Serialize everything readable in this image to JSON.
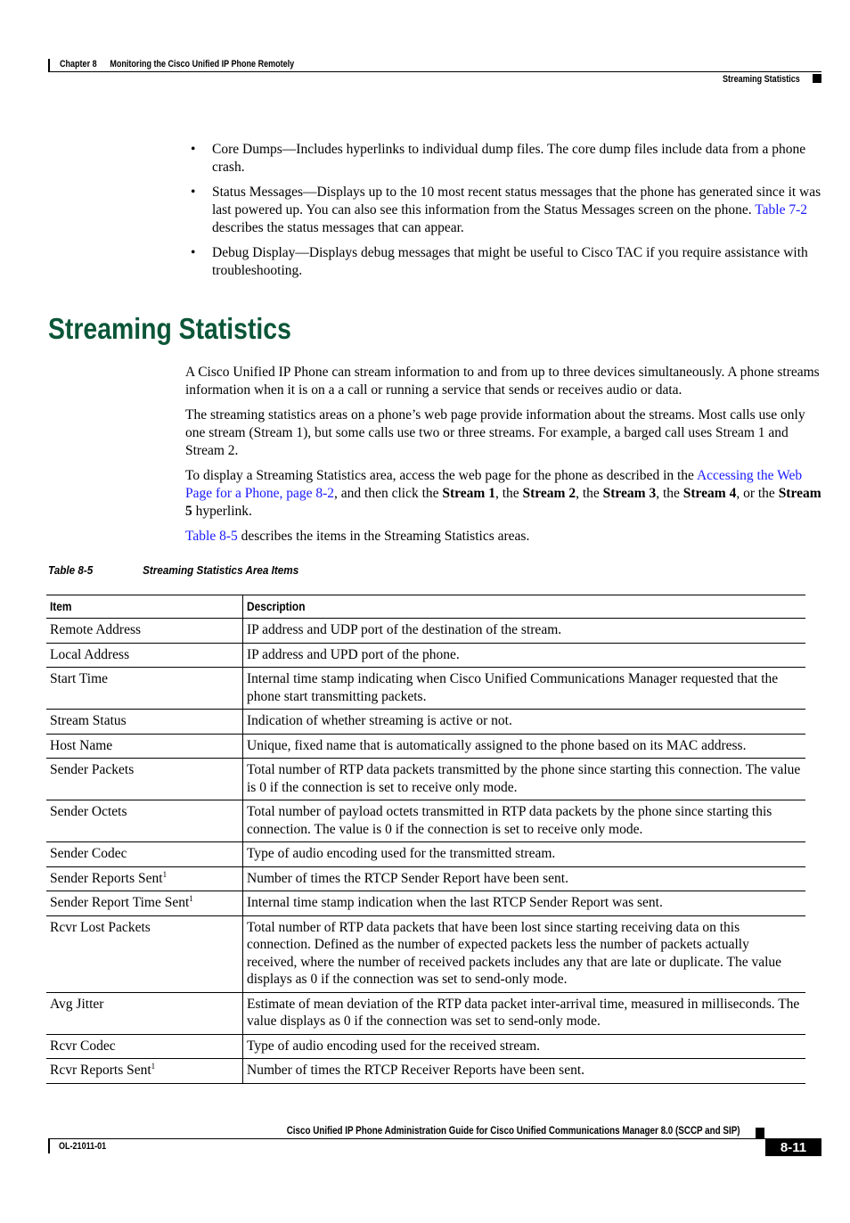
{
  "header": {
    "chapter_label": "Chapter 8",
    "chapter_title": "Monitoring the Cisco Unified IP Phone Remotely",
    "section": "Streaming Statistics"
  },
  "bullets": [
    {
      "term": "Core Dumps",
      "text": "—Includes hyperlinks to individual dump files. The core dump files include data from a phone crash."
    },
    {
      "term": "Status Messages",
      "text_before_link": "—Displays up to the 10 most recent status messages that the phone has generated since it was last powered up. You can also see this information from the Status Messages screen on the phone. ",
      "link": "Table 7-2",
      "text_after_link": " describes the status messages that can appear."
    },
    {
      "term": "Debug Display",
      "text": "—Displays debug messages that might be useful to Cisco TAC if you require assistance with troubleshooting."
    }
  ],
  "section_heading": "Streaming Statistics",
  "paragraphs": {
    "p1": "A Cisco Unified IP Phone can stream information to and from up to three devices simultaneously. A phone streams information when it is on a a call or running a service that sends or receives audio or data.",
    "p2": "The streaming statistics areas on a phone’s web page provide information about the streams. Most calls use only one stream (Stream 1), but some calls use two or three streams. For example, a barged call uses Stream 1 and Stream 2.",
    "p3": {
      "before_link": "To display a Streaming Statistics area, access the web page for the phone as described in the ",
      "link": "Accessing the Web Page for a Phone, page 8-2",
      "after_link": ", and then click the ",
      "s1": "Stream 1",
      "sep1": ", the ",
      "s2": "Stream 2",
      "sep2": ", the ",
      "s3": "Stream 3",
      "sep3": ", the ",
      "s4": "Stream 4",
      "sep4": ", or the ",
      "s5": "Stream 5",
      "end": " hyperlink."
    },
    "p4": {
      "link": "Table 8-5",
      "text": " describes the items in the Streaming Statistics areas."
    }
  },
  "table": {
    "caption_number": "Table 8-5",
    "caption_title": "Streaming Statistics Area Items",
    "headers": [
      "Item",
      "Description"
    ],
    "rows": [
      {
        "item": "Remote Address",
        "footnote": "",
        "description": "IP address and UDP port of the destination of the stream."
      },
      {
        "item": "Local Address",
        "footnote": "",
        "description": "IP address and UPD port of the phone."
      },
      {
        "item": "Start Time",
        "footnote": "",
        "description": "Internal time stamp indicating when Cisco Unified Communications Manager requested that the phone start transmitting packets."
      },
      {
        "item": "Stream Status",
        "footnote": "",
        "description": "Indication of whether streaming is active or not."
      },
      {
        "item": "Host Name",
        "footnote": "",
        "description": "Unique, fixed name that is automatically assigned to the phone based on its MAC address."
      },
      {
        "item": "Sender Packets",
        "footnote": "",
        "description": "Total number of RTP data packets transmitted by the phone since starting this connection. The value is 0 if the connection is set to receive only mode."
      },
      {
        "item": "Sender Octets",
        "footnote": "",
        "description": "Total number of payload octets transmitted in RTP data packets by the phone since starting this connection. The value is 0 if the connection is set to receive only mode."
      },
      {
        "item": "Sender Codec",
        "footnote": "",
        "description": "Type of audio encoding used for the transmitted stream."
      },
      {
        "item": "Sender Reports Sent",
        "footnote": "1",
        "description": "Number of times the RTCP Sender Report have been sent."
      },
      {
        "item": "Sender Report Time Sent",
        "footnote": "1",
        "description": "Internal time stamp indication when the last RTCP Sender Report was sent."
      },
      {
        "item": "Rcvr Lost Packets",
        "footnote": "",
        "description": "Total number of RTP data packets that have been lost since starting receiving data on this connection. Defined as the number of expected packets less the number of packets actually received, where the number of received packets includes any that are late or duplicate. The value displays as 0 if the connection was set to send-only mode."
      },
      {
        "item": "Avg Jitter",
        "footnote": "",
        "description": "Estimate of mean deviation of the RTP data packet inter-arrival time, measured in milliseconds. The value displays as 0 if the connection was set to send-only mode."
      },
      {
        "item": "Rcvr Codec",
        "footnote": "",
        "description": "Type of audio encoding used for the received stream."
      },
      {
        "item": "Rcvr Reports Sent",
        "footnote": "1",
        "description": "Number of times the RTCP Receiver Reports have been sent."
      }
    ]
  },
  "footer": {
    "guide_title": "Cisco Unified IP Phone Administration Guide for Cisco Unified Communications Manager 8.0 (SCCP and SIP)",
    "doc_number": "OL-21011-01",
    "page_number": "8-11"
  }
}
